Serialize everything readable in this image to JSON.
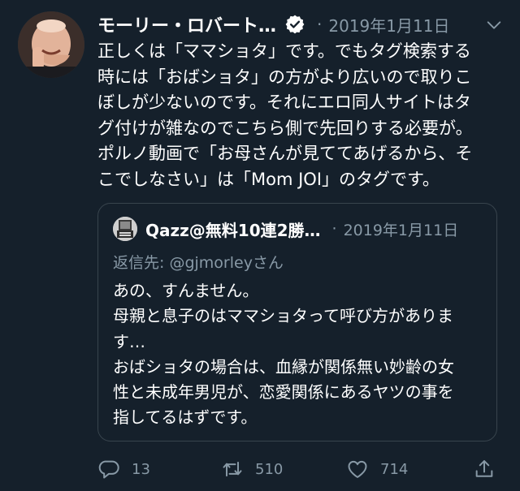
{
  "tweet": {
    "author_name": "モーリー・ロバート…",
    "verified_icon": "verified-badge-icon",
    "separator": "·",
    "date": "2019年1月11日",
    "menu_icon": "chevron-down-icon",
    "text_lines": [
      "正しくは「ママショタ」です。でもタグ検索する",
      "時には「おばショタ」の方がより広いので取りこ",
      "ぼしが少ないのです。それにエロ同人サイトはタ",
      "グ付けが雑なのでこちら側で先回りする必要が。",
      "ポルノ動画で「お母さんが見ててあげるから、そ",
      "こでしなさい」は「Mom JOI」のタグです。"
    ]
  },
  "quote": {
    "author_name": "Qazz@無料10連2勝…",
    "separator": "·",
    "date": "2019年1月11日",
    "reply_to": "返信先: @gjmorleyさん",
    "text_lines": [
      "あの、すんません。",
      "母親と息子のはママショタって呼び方がありま",
      "す…",
      "おばショタの場合は、血縁が関係無い妙齢の女",
      "性と未成年男児が、恋愛関係にあるヤツの事を",
      "指してるはずです。"
    ]
  },
  "actions": {
    "reply_icon": "reply-icon",
    "reply_count": "13",
    "retweet_icon": "retweet-icon",
    "retweet_count": "510",
    "like_icon": "heart-icon",
    "like_count": "714",
    "share_icon": "share-icon"
  },
  "colors": {
    "background": "#15202b",
    "secondary_text": "#8899a6",
    "border": "#38444d",
    "verified": "#ffffff"
  }
}
